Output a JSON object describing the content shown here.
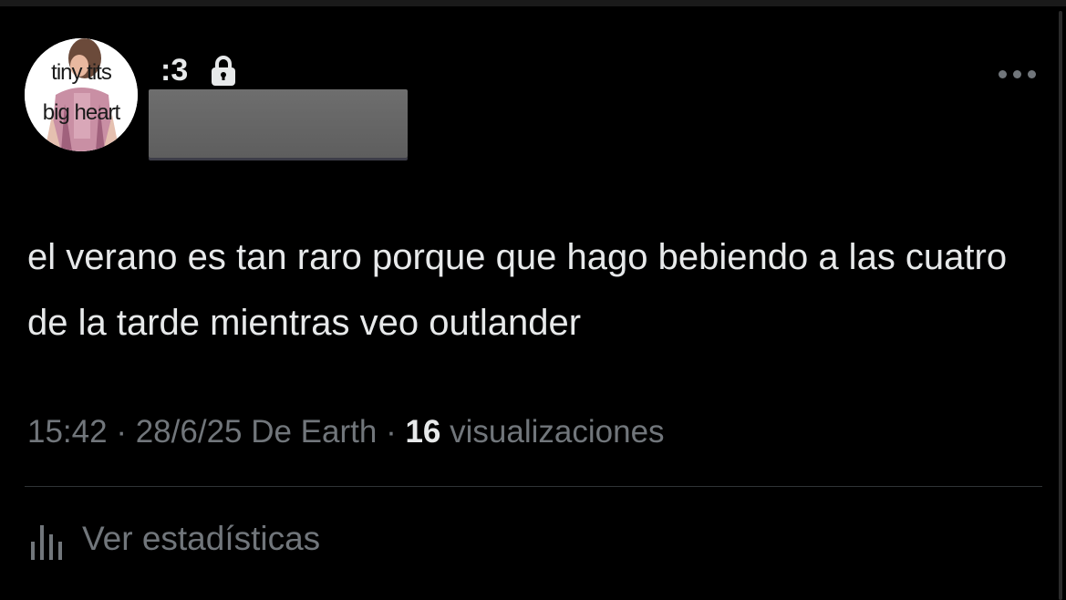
{
  "author": {
    "avatar_line1": "tiny tits",
    "avatar_line2": "big heart",
    "display_name": ":3",
    "protected_icon": "lock-icon"
  },
  "tweet": {
    "text": "el verano es tan raro porque que hago bebiendo a las cuatro de la tarde mientras veo outlander",
    "time": "15:42",
    "separator": "·",
    "date_source": "28/6/25 De Earth",
    "view_count": "16",
    "views_label": "visualizaciones"
  },
  "actions": {
    "more_icon": "more-horizontal-icon",
    "stats_icon": "bar-chart-icon",
    "stats_label": "Ver estadísticas"
  },
  "colors": {
    "background": "#000000",
    "primary_text": "#e7e9ea",
    "secondary_text": "#71767b",
    "divider": "#2f3336"
  }
}
